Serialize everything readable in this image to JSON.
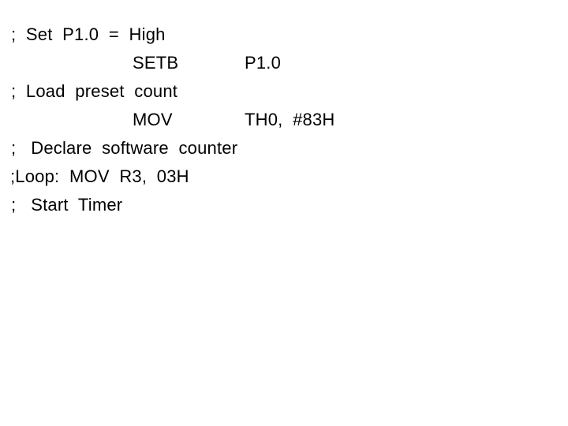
{
  "slide": {
    "background_color": "#ffffff",
    "text_color": "#000000",
    "lines": [
      {
        "id": "comment-set-p1-high",
        "kind": "comment",
        "text": ";  Set  P1.0  =  High"
      },
      {
        "id": "instruction-setb",
        "kind": "instruction",
        "mnemonic": "SETB",
        "operands": "P1.0"
      },
      {
        "id": "comment-load-preset-count",
        "kind": "comment",
        "text": ";  Load  preset  count"
      },
      {
        "id": "instruction-mov-th0",
        "kind": "instruction",
        "mnemonic": "MOV",
        "operands": "TH0,  #83H"
      },
      {
        "id": "comment-declare-software-counter",
        "kind": "comment",
        "text": ";   Declare  software  counter"
      },
      {
        "id": "comment-loop-mov-r3",
        "kind": "label-comment",
        "text": ";Loop:  MOV  R3,  03H"
      },
      {
        "id": "comment-start-timer",
        "kind": "comment",
        "text": ";   Start  Timer"
      }
    ]
  }
}
